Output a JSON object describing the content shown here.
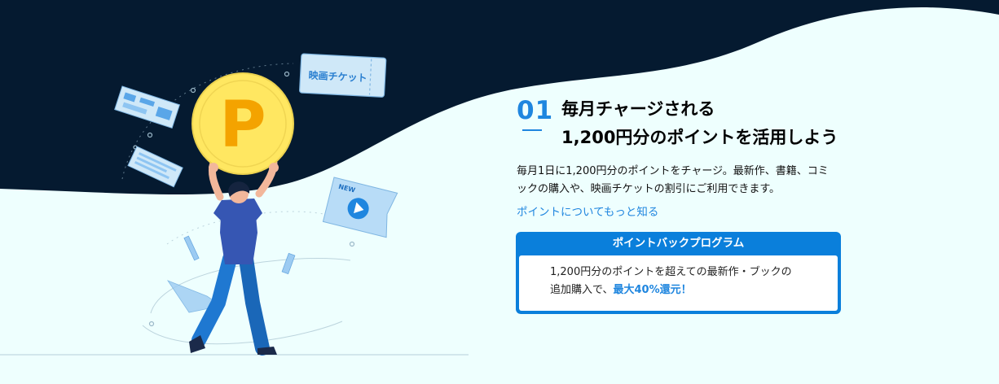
{
  "colors": {
    "dark_navy": "#051a30",
    "background": "#eefffe",
    "accent_blue": "#1f86df",
    "coin_yellow": "#ffe761",
    "coin_letter": "#f4a300",
    "shirt_blue": "#3656b3",
    "pants_blue": "#1f78d1"
  },
  "illustration": {
    "coin_letter": "P",
    "ticket_text": "映画チケット",
    "flag_badge": "NEW",
    "icons": [
      "coin-icon",
      "movie-ticket-icon",
      "new-flag-icon",
      "play-icon",
      "magazine-page-icon"
    ]
  },
  "feature": {
    "number": "01",
    "title_line1": "毎月チャージされる",
    "title_line2": "1,200円分のポイントを活用しよう",
    "description": "毎月1日に1,200円分のポイントをチャージ。最新作、書籍、コミックの購入や、映画チケットの割引にご利用できます。",
    "link_label": "ポイントについてもっと知る"
  },
  "point_back": {
    "title": "ポイントバックプログラム",
    "body_line1": "1,200円分のポイントを超えての最新作・ブックの",
    "body_line2_prefix": "追加購入で、",
    "body_highlight": "最大40%還元！"
  }
}
